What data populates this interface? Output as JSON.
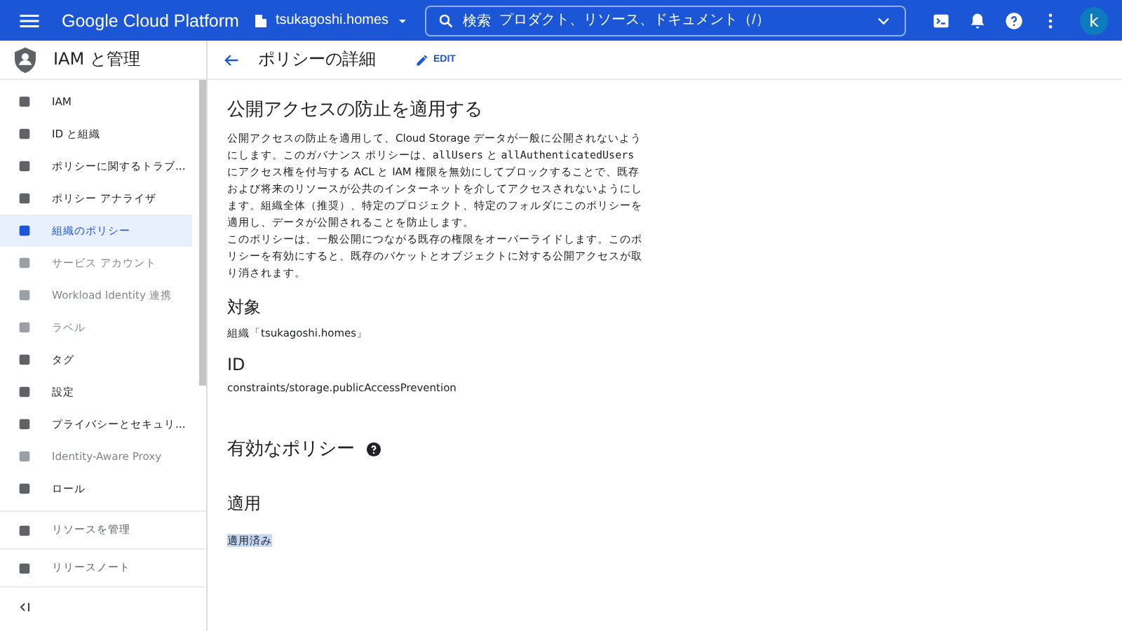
{
  "header": {
    "product": "Google Cloud Platform",
    "project": "tsukagoshi.homes",
    "search": {
      "label": "検索",
      "placeholder": "プロダクト、リソース、ドキュメント（/）"
    },
    "avatar": "k"
  },
  "sidebar": {
    "title": "IAM と管理",
    "items": [
      {
        "label": "IAM",
        "selected": false,
        "disabled": false
      },
      {
        "label": "ID と組織",
        "selected": false,
        "disabled": false
      },
      {
        "label": "ポリシーに関するトラブ...",
        "selected": false,
        "disabled": false
      },
      {
        "label": "ポリシー アナライザ",
        "selected": false,
        "disabled": false
      },
      {
        "label": "組織のポリシー",
        "selected": true,
        "disabled": false
      },
      {
        "label": "サービス アカウント",
        "selected": false,
        "disabled": true
      },
      {
        "label": "Workload Identity 連携",
        "selected": false,
        "disabled": true
      },
      {
        "label": "ラベル",
        "selected": false,
        "disabled": true
      },
      {
        "label": "タグ",
        "selected": false,
        "disabled": false
      },
      {
        "label": "設定",
        "selected": false,
        "disabled": false
      },
      {
        "label": "プライバシーとセキュリ...",
        "selected": false,
        "disabled": false
      },
      {
        "label": "Identity-Aware Proxy",
        "selected": false,
        "disabled": true
      },
      {
        "label": "ロール",
        "selected": false,
        "disabled": false
      }
    ],
    "footer_items": [
      {
        "label": "リソースを管理"
      },
      {
        "label": "リリースノート"
      }
    ]
  },
  "page": {
    "title": "ポリシーの詳細",
    "edit": "EDIT",
    "heading": "公開アクセスの防止を適用する",
    "paragraphs": [
      [
        {
          "kind": "text",
          "text": "公開アクセスの防止を適用して、Cloud Storage データが一般に公開されないようにします。このガバナンス ポリシーは、"
        },
        {
          "kind": "code",
          "text": "allUsers"
        },
        {
          "kind": "text",
          "text": " と "
        },
        {
          "kind": "code",
          "text": "allAuthenticatedUsers"
        },
        {
          "kind": "text",
          "text": " にアクセス権を付与する ACL と IAM 権限を無効にしてブロックすることで、既存および将来のリソースが公共のインターネットを介してアクセスされないようにします。組織全体（推奨）、特定のプロジェクト、特定のフォルダにこのポリシーを適用し、データが公開されることを防止します。"
        }
      ],
      [
        {
          "kind": "text",
          "text": "このポリシーは、一般公開につながる既存の権限をオーバーライドします。このポリシーを有効にすると、既存のバケットとオブジェクトに対する公開アクセスが取り消されます。"
        }
      ]
    ],
    "target_heading": "対象",
    "target": "組織「tsukagoshi.homes」",
    "id_heading": "ID",
    "id": "constraints/storage.publicAccessPrevention",
    "effective_heading": "有効なポリシー",
    "enforce_heading": "適用",
    "enforce_value": {
      "text": "適用済み",
      "highlighted": true
    }
  }
}
